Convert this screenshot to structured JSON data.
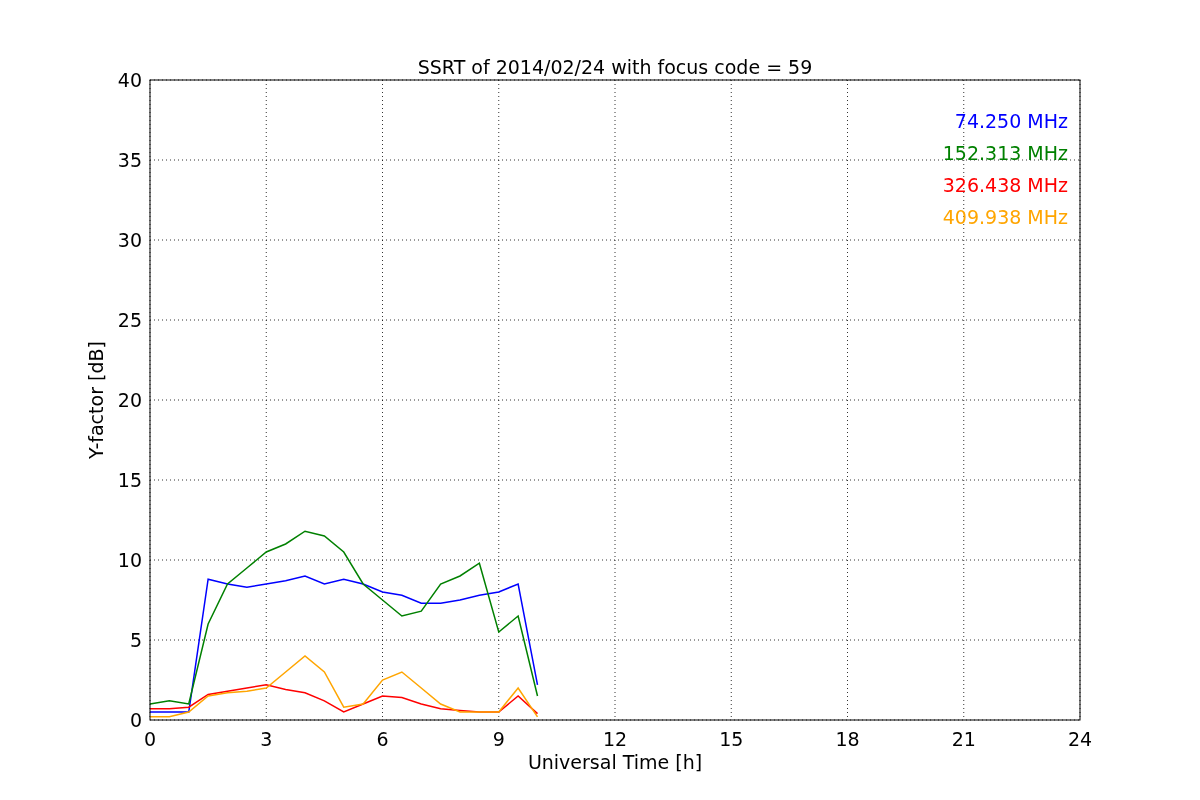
{
  "chart_data": {
    "type": "line",
    "title": "SSRT of 2014/02/24 with focus code = 59",
    "xlabel": "Universal Time [h]",
    "ylabel": "Y-factor [dB]",
    "x": [
      0,
      0.5,
      1,
      1.5,
      2,
      2.5,
      3,
      3.5,
      4,
      4.5,
      5,
      5.5,
      6,
      6.5,
      7,
      7.5,
      8,
      8.5,
      9,
      9.5,
      10
    ],
    "series": [
      {
        "name": "74.250 MHz",
        "color": "#0000ff",
        "values": [
          0.5,
          0.5,
          0.5,
          8.8,
          8.5,
          8.3,
          8.5,
          8.7,
          9.0,
          8.5,
          8.8,
          8.5,
          8.0,
          7.8,
          7.3,
          7.3,
          7.5,
          7.8,
          8.0,
          8.5,
          2.2
        ]
      },
      {
        "name": "152.313 MHz",
        "color": "#008000",
        "values": [
          1.0,
          1.2,
          1.0,
          6.0,
          8.5,
          9.5,
          10.5,
          11.0,
          11.8,
          11.5,
          10.5,
          8.5,
          7.5,
          6.5,
          6.8,
          8.5,
          9.0,
          9.8,
          5.5,
          6.5,
          1.5
        ]
      },
      {
        "name": "326.438 MHz",
        "color": "#ff0000",
        "values": [
          0.7,
          0.7,
          0.8,
          1.6,
          1.8,
          2.0,
          2.2,
          1.9,
          1.7,
          1.2,
          0.5,
          1.0,
          1.5,
          1.4,
          1.0,
          0.7,
          0.6,
          0.5,
          0.5,
          1.5,
          0.4
        ]
      },
      {
        "name": "409.938 MHz",
        "color": "#ffa500",
        "values": [
          0.2,
          0.2,
          0.5,
          1.5,
          1.7,
          1.8,
          2.0,
          3.0,
          4.0,
          3.0,
          0.8,
          1.0,
          2.5,
          3.0,
          2.0,
          1.0,
          0.5,
          0.5,
          0.5,
          2.0,
          0.2
        ]
      }
    ],
    "grid": true,
    "xlim": [
      0,
      24
    ],
    "ylim": [
      0,
      40
    ],
    "xticks": [
      0,
      3,
      6,
      9,
      12,
      15,
      18,
      21,
      24
    ],
    "yticks": [
      0,
      5,
      10,
      15,
      20,
      25,
      30,
      35,
      40
    ]
  }
}
